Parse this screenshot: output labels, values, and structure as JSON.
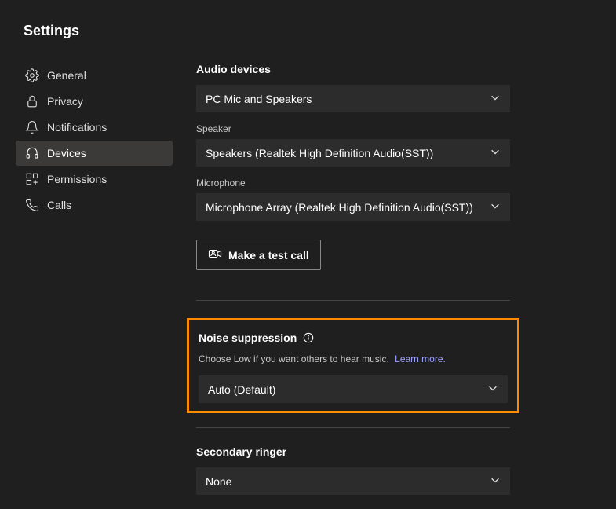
{
  "header": {
    "title": "Settings"
  },
  "sidebar": {
    "items": [
      {
        "label": "General"
      },
      {
        "label": "Privacy"
      },
      {
        "label": "Notifications"
      },
      {
        "label": "Devices"
      },
      {
        "label": "Permissions"
      },
      {
        "label": "Calls"
      }
    ]
  },
  "audio_devices": {
    "heading": "Audio devices",
    "device_select": "PC Mic and Speakers",
    "speaker_label": "Speaker",
    "speaker_select": "Speakers (Realtek High Definition Audio(SST))",
    "mic_label": "Microphone",
    "mic_select": "Microphone Array (Realtek High Definition Audio(SST))",
    "test_call_label": "Make a test call"
  },
  "noise": {
    "heading": "Noise suppression",
    "help_text": "Choose Low if you want others to hear music.",
    "learn_more": "Learn more.",
    "select": "Auto (Default)"
  },
  "secondary_ringer": {
    "heading": "Secondary ringer",
    "select": "None"
  }
}
